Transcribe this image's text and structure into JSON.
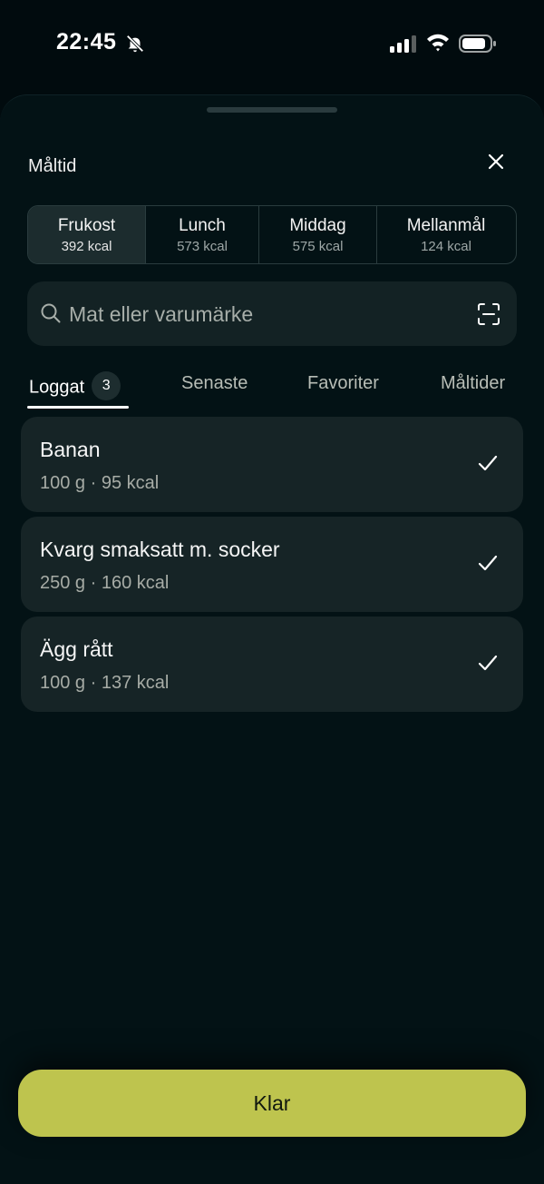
{
  "status_bar": {
    "time": "22:45"
  },
  "sheet": {
    "title": "Måltid"
  },
  "meals": [
    {
      "name": "Frukost",
      "kcal": "392 kcal",
      "active": true
    },
    {
      "name": "Lunch",
      "kcal": "573 kcal",
      "active": false
    },
    {
      "name": "Middag",
      "kcal": "575 kcal",
      "active": false
    },
    {
      "name": "Mellanmål",
      "kcal": "124 kcal",
      "active": false
    }
  ],
  "search": {
    "placeholder": "Mat eller varumärke"
  },
  "tabs": {
    "logged": {
      "label": "Loggat",
      "count": "3"
    },
    "recent": {
      "label": "Senaste"
    },
    "favorites": {
      "label": "Favoriter"
    },
    "meals": {
      "label": "Måltider"
    }
  },
  "foods": [
    {
      "name": "Banan",
      "meta": "100 g · 95 kcal",
      "checked": true
    },
    {
      "name": "Kvarg smaksatt m. socker",
      "meta": "250 g · 160 kcal",
      "checked": true
    },
    {
      "name": "Ägg rått",
      "meta": "100 g · 137 kcal",
      "checked": true
    }
  ],
  "actions": {
    "done_label": "Klar"
  },
  "colors": {
    "background": "#010b0e",
    "surface": "#162426",
    "accent": "#bec44e"
  }
}
